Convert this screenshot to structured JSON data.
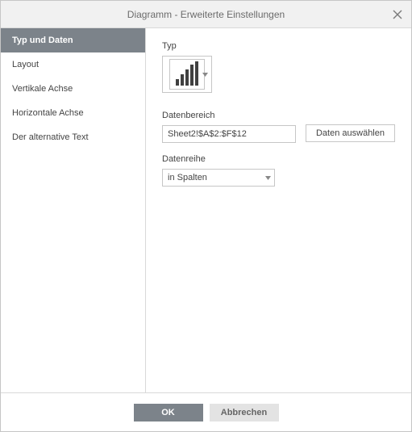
{
  "dialog": {
    "title": "Diagramm - Erweiterte Einstellungen"
  },
  "sidebar": {
    "items": [
      {
        "label": "Typ und Daten",
        "active": true
      },
      {
        "label": "Layout",
        "active": false
      },
      {
        "label": "Vertikale Achse",
        "active": false
      },
      {
        "label": "Horizontale Achse",
        "active": false
      },
      {
        "label": "Der alternative Text",
        "active": false
      }
    ]
  },
  "main": {
    "type_label": "Typ",
    "chart_type": "column-chart",
    "data_range_label": "Datenbereich",
    "data_range_value": "Sheet2!$A$2:$F$12",
    "select_data_button": "Daten auswählen",
    "data_series_label": "Datenreihe",
    "data_series_value": "in Spalten"
  },
  "footer": {
    "ok": "OK",
    "cancel": "Abbrechen"
  }
}
